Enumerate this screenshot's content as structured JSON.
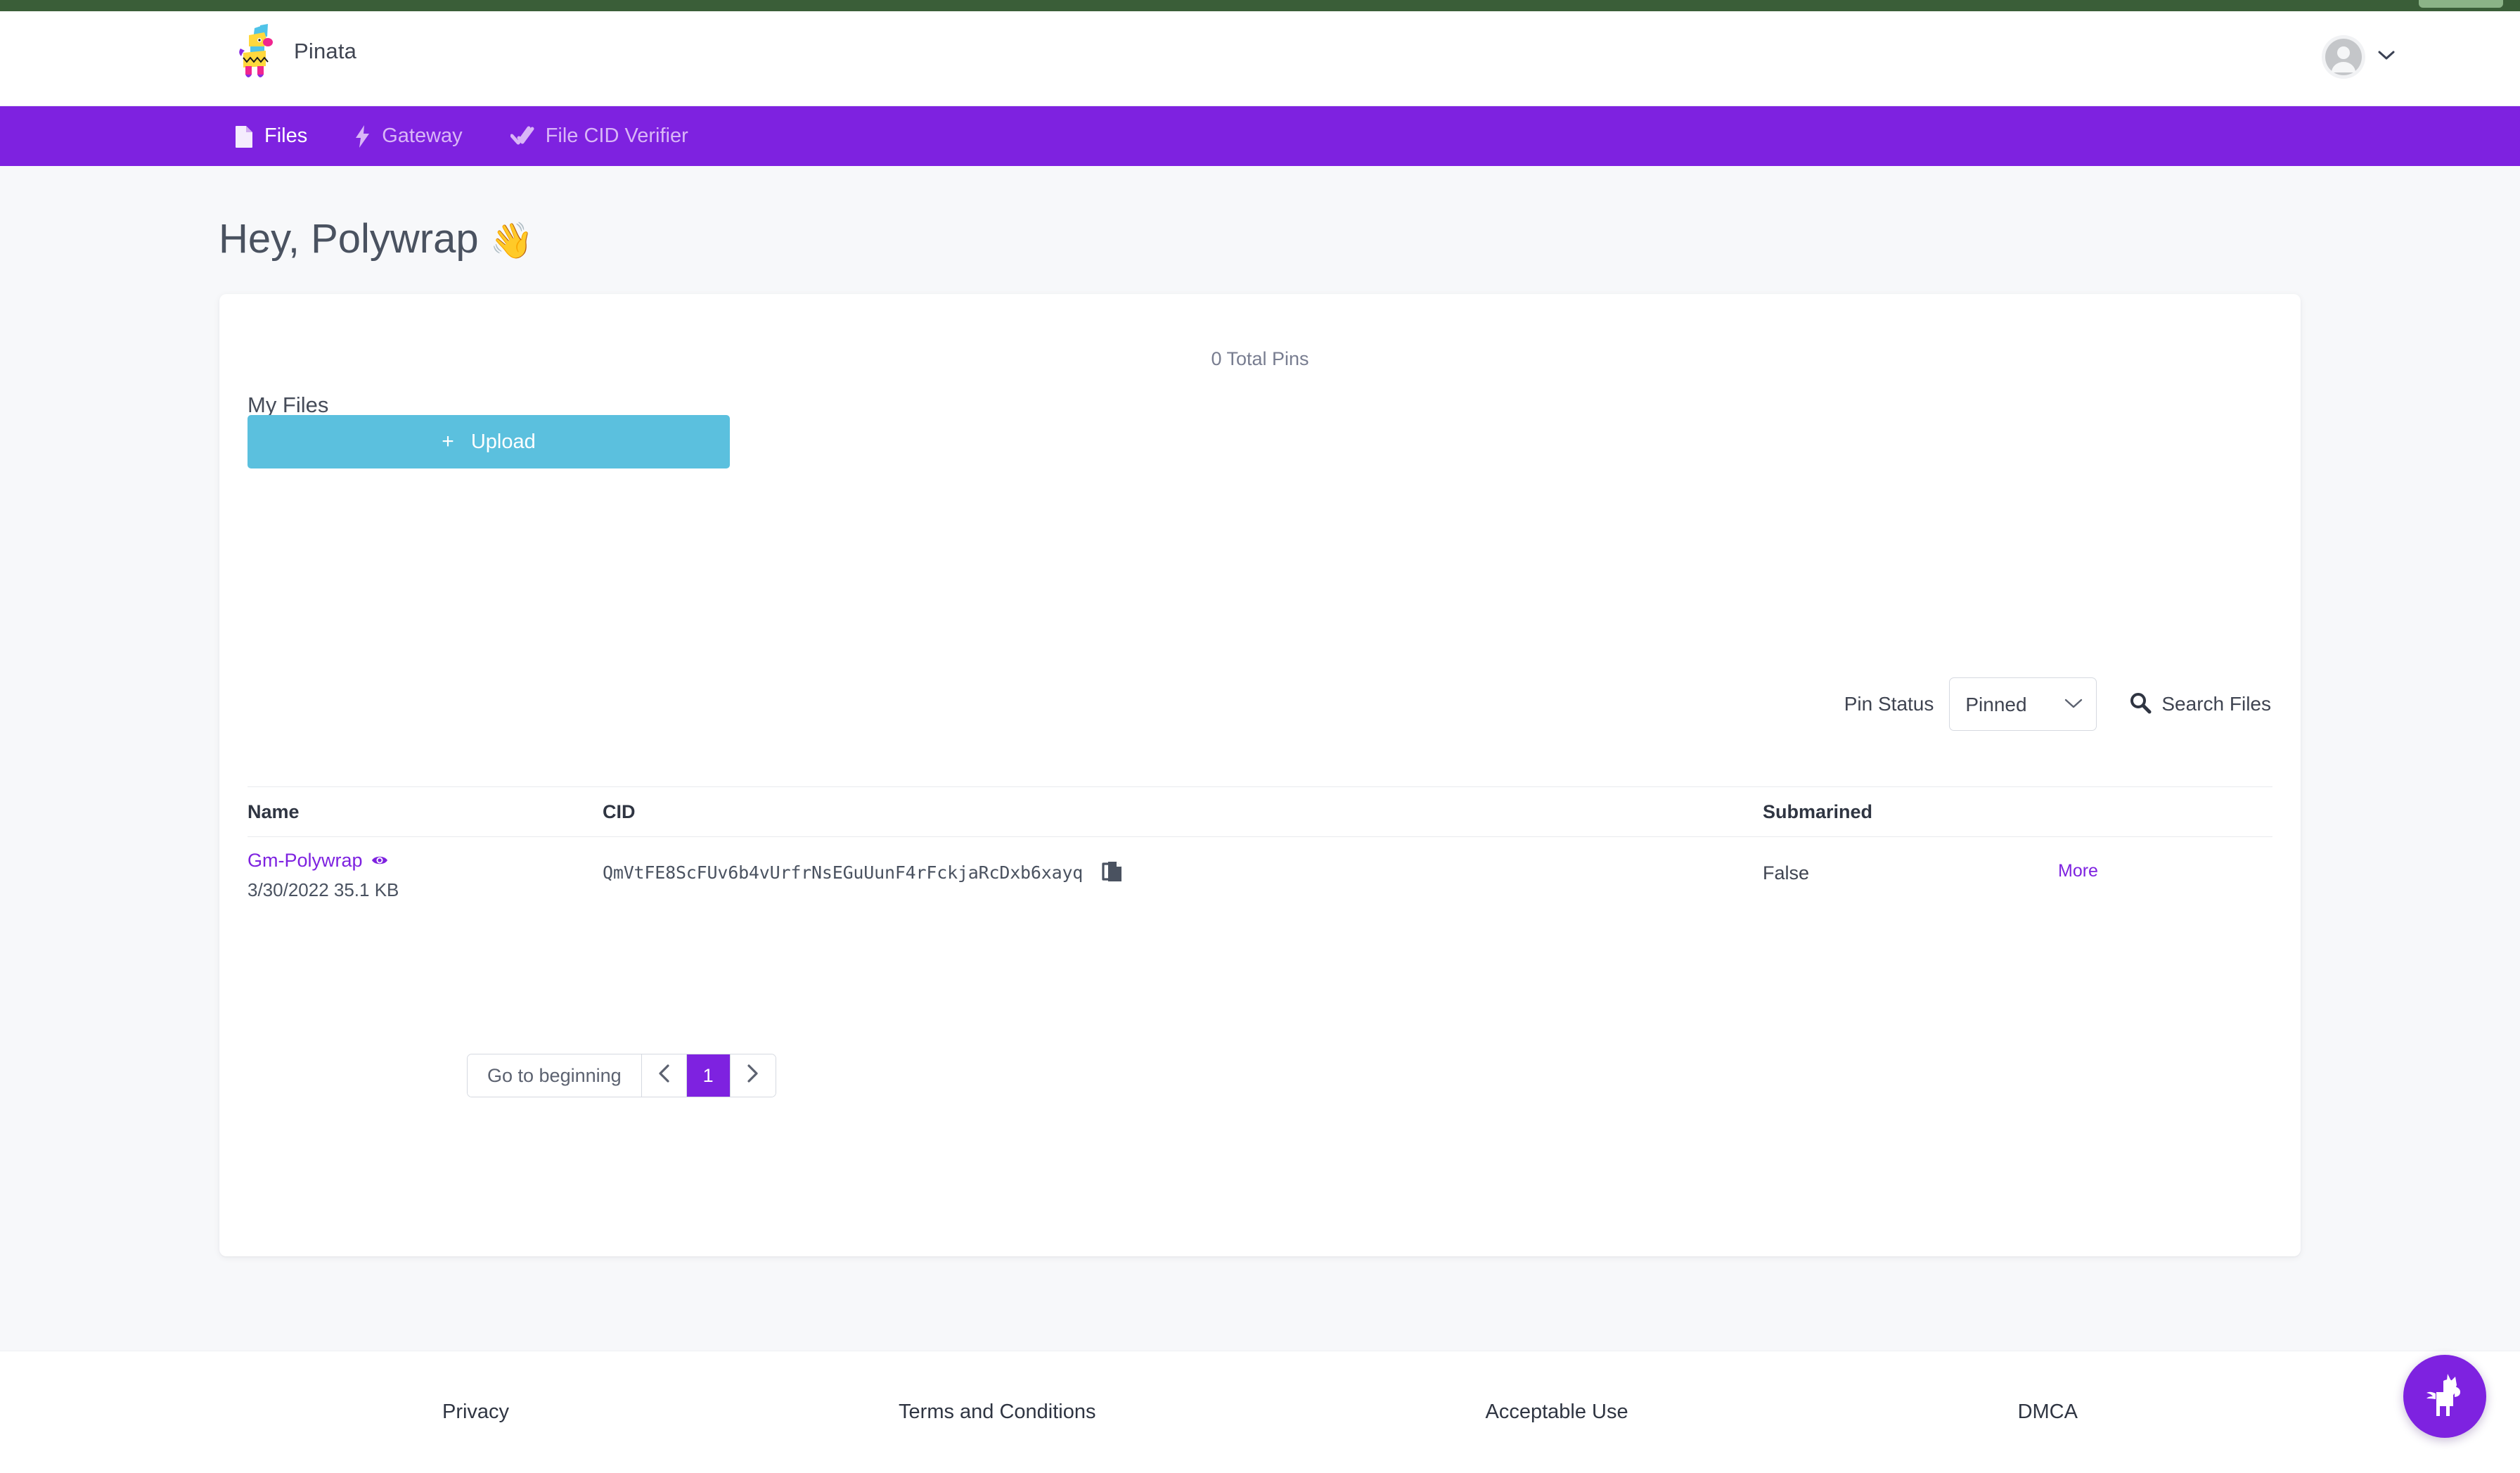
{
  "brand": {
    "name": "Pinata",
    "logo_icon": "pinata-llama-icon"
  },
  "account": {
    "avatar_icon": "user-avatar-icon",
    "caret_icon": "chevron-down-icon"
  },
  "nav": {
    "items": [
      {
        "label": "Files",
        "icon": "file-icon",
        "active": true
      },
      {
        "label": "Gateway",
        "icon": "bolt-icon",
        "active": false
      },
      {
        "label": "File CID Verifier",
        "icon": "double-check-icon",
        "active": false
      }
    ]
  },
  "page": {
    "greeting": "Hey, Polywrap",
    "greeting_emoji": "👋"
  },
  "card": {
    "total_pins": "0 Total Pins",
    "section_title": "My Files",
    "upload_label": "Upload",
    "upload_plus": "+",
    "filters": {
      "pin_status_label": "Pin Status",
      "pin_status_value": "Pinned",
      "pin_status_options": [
        "Pinned"
      ],
      "search_label": "Search Files",
      "search_icon": "magnifier-icon"
    },
    "table": {
      "columns": [
        "Name",
        "CID",
        "Submarined",
        ""
      ],
      "rows": [
        {
          "name": "Gm-Polywrap",
          "name_icon": "eye-icon",
          "date": "3/30/2022",
          "size": "35.1 KB",
          "meta": "3/30/2022 35.1 KB",
          "cid": "QmVtFE8ScFUv6b4vUrfrNsEGuUunF4rFckjaRcDxb6xayq",
          "copy_icon": "copy-icon",
          "submarined": "False",
          "more_label": "More"
        }
      ]
    },
    "pagination": {
      "go_to_beginning": "Go to beginning",
      "prev_icon": "chevron-left-icon",
      "next_icon": "chevron-right-icon",
      "current_page": "1"
    }
  },
  "footer": {
    "links": [
      "Privacy",
      "Terms and Conditions",
      "Acceptable Use",
      "DMCA"
    ]
  },
  "fab": {
    "icon": "pinata-llama-icon"
  },
  "colors": {
    "brand_purple": "#7e22e0",
    "upload_blue": "#5bc0de",
    "page_bg": "#f7f8fa",
    "top_strip_green": "#3a5e38"
  }
}
